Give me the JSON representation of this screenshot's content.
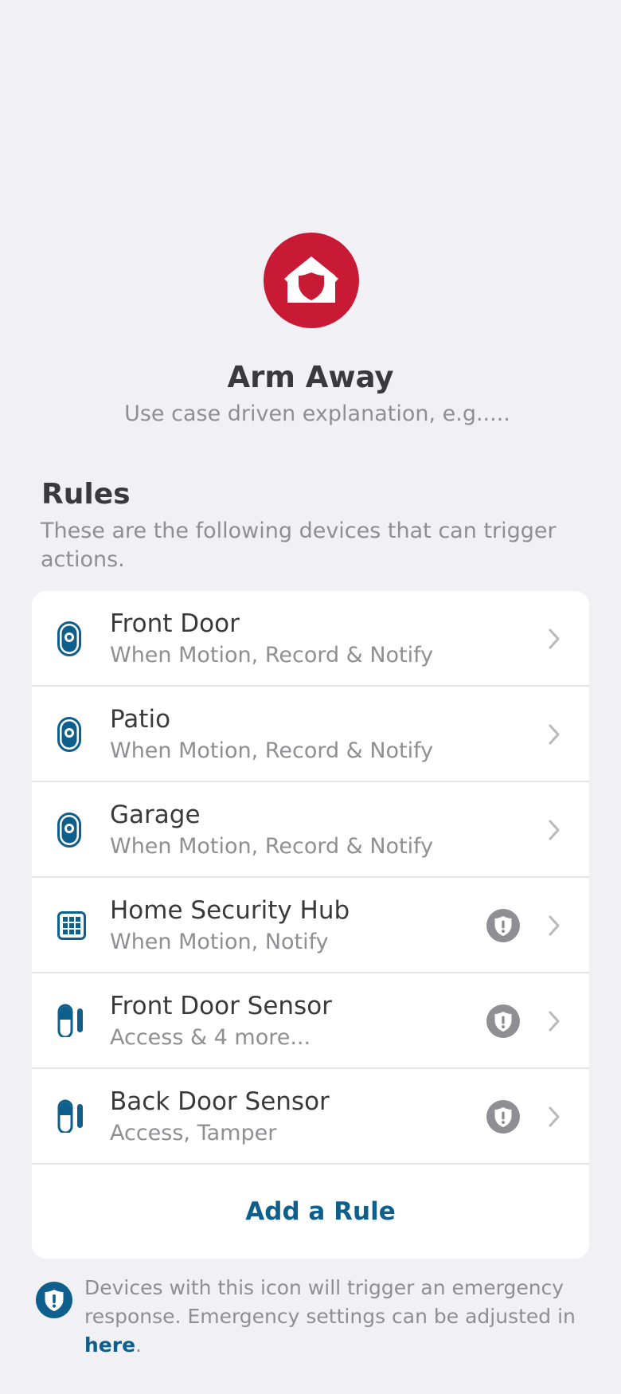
{
  "mode": {
    "title": "Arm Away",
    "subtitle": "Use case driven explanation, e.g.....",
    "icon": "home-shield-icon",
    "accent_color": "#c91a35"
  },
  "rules": {
    "heading": "Rules",
    "description": "These are the following devices that can trigger actions.",
    "items": [
      {
        "name": "Front Door",
        "detail": "When Motion, Record & Notify",
        "icon": "camera-icon",
        "emergency": false
      },
      {
        "name": "Patio",
        "detail": "When Motion, Record & Notify",
        "icon": "camera-icon",
        "emergency": false
      },
      {
        "name": "Garage",
        "detail": "When Motion, Record & Notify",
        "icon": "camera-icon",
        "emergency": false
      },
      {
        "name": "Home Security Hub",
        "detail": "When Motion, Notify",
        "icon": "keypad-icon",
        "emergency": true
      },
      {
        "name": "Front Door Sensor",
        "detail": "Access & 4 more...",
        "icon": "contact-sensor-icon",
        "emergency": true
      },
      {
        "name": "Back Door Sensor",
        "detail": "Access, Tamper",
        "icon": "contact-sensor-icon",
        "emergency": true
      }
    ],
    "add_label": "Add a Rule"
  },
  "footer": {
    "note": "Devices with this icon will trigger an emergency response. Emergency settings can be adjusted in",
    "link_label": "here",
    "end": "."
  },
  "colors": {
    "background": "#f1f0f5",
    "brand_blue": "#0e5f8c",
    "muted_text": "#8e8e93",
    "badge_gray": "#8e8e93"
  }
}
